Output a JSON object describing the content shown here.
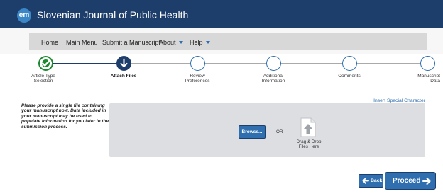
{
  "header": {
    "logo_text": "em",
    "journal_title": "Slovenian Journal of Public Health"
  },
  "nav": {
    "home": "Home",
    "main_menu": "Main Menu",
    "submit": "Submit a Manuscript",
    "about": "About",
    "help": "Help"
  },
  "steps": [
    {
      "label_line1": "Article Type",
      "label_line2": "Selection",
      "state": "completed"
    },
    {
      "label_line1": "Attach Files",
      "label_line2": "",
      "state": "current"
    },
    {
      "label_line1": "Review",
      "label_line2": "Preferences",
      "state": "pending"
    },
    {
      "label_line1": "Additional",
      "label_line2": "Information",
      "state": "pending"
    },
    {
      "label_line1": "Comments",
      "label_line2": "",
      "state": "pending"
    },
    {
      "label_line1": "Manuscript",
      "label_line2": "Data",
      "state": "pending"
    }
  ],
  "content": {
    "instructions": "Please provide a single file containing your manuscript now. Data included in your manuscript may be used to populate information for you later in the submission process.",
    "special_character_link": "Insert Special Character",
    "browse_label": "Browse...",
    "or_label": "OR",
    "drag_drop_line1": "Drag & Drop",
    "drag_drop_line2": "Files Here"
  },
  "footer": {
    "back_label": "Back",
    "proceed_label": "Proceed"
  },
  "colors": {
    "header_bg": "#1d3d6a",
    "accent_blue": "#2f6fb0",
    "completed_green": "#1b8a2e",
    "dropzone_bg": "#dcdee2",
    "nav_bar_bg": "#d8d8d8"
  }
}
